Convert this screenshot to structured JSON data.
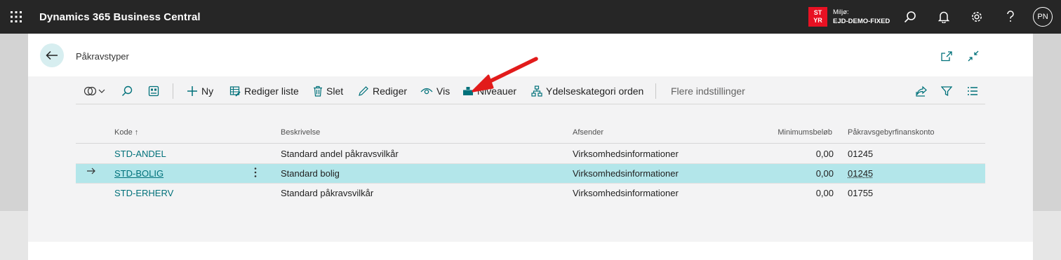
{
  "header": {
    "app_name": "Dynamics 365 Business Central",
    "env_badge_line1": "ST",
    "env_badge_line2": "YR",
    "env_label": "Miljø:",
    "env_name": "EJD-DEMO-FIXED",
    "avatar_initials": "PN",
    "icons": [
      "waffle-icon",
      "search-icon",
      "bell-icon",
      "gear-icon",
      "help-icon"
    ],
    "badge_color": "#e81123"
  },
  "page": {
    "title": "Påkravstyper"
  },
  "actions": {
    "new": "Ny",
    "edit_list": "Rediger liste",
    "delete": "Slet",
    "edit": "Rediger",
    "view": "Vis",
    "levels": "Niveauer",
    "category_order": "Ydelseskategori orden",
    "more": "Flere indstillinger"
  },
  "table": {
    "columns": {
      "code": "Kode ↑",
      "description": "Beskrivelse",
      "sender": "Afsender",
      "min_amount": "Minimumsbeløb",
      "fee_account": "Påkravsgebyrfinanskonto"
    },
    "rows": [
      {
        "code": "STD-ANDEL",
        "description": "Standard andel påkravsvilkår",
        "sender": "Virksomhedsinformationer",
        "min_amount": "0,00",
        "fee_account": "01245"
      },
      {
        "code": "STD-BOLIG",
        "description": "Standard bolig",
        "sender": "Virksomhedsinformationer",
        "min_amount": "0,00",
        "fee_account": "01245"
      },
      {
        "code": "STD-ERHERV",
        "description": "Standard påkravsvilkår",
        "sender": "Virksomhedsinformationer",
        "min_amount": "0,00",
        "fee_account": "01755"
      }
    ],
    "selected_row": 1
  },
  "colors": {
    "accent": "#00717a",
    "selected_row": "#b3e6ea",
    "annotation_arrow": "#e21b1b"
  }
}
